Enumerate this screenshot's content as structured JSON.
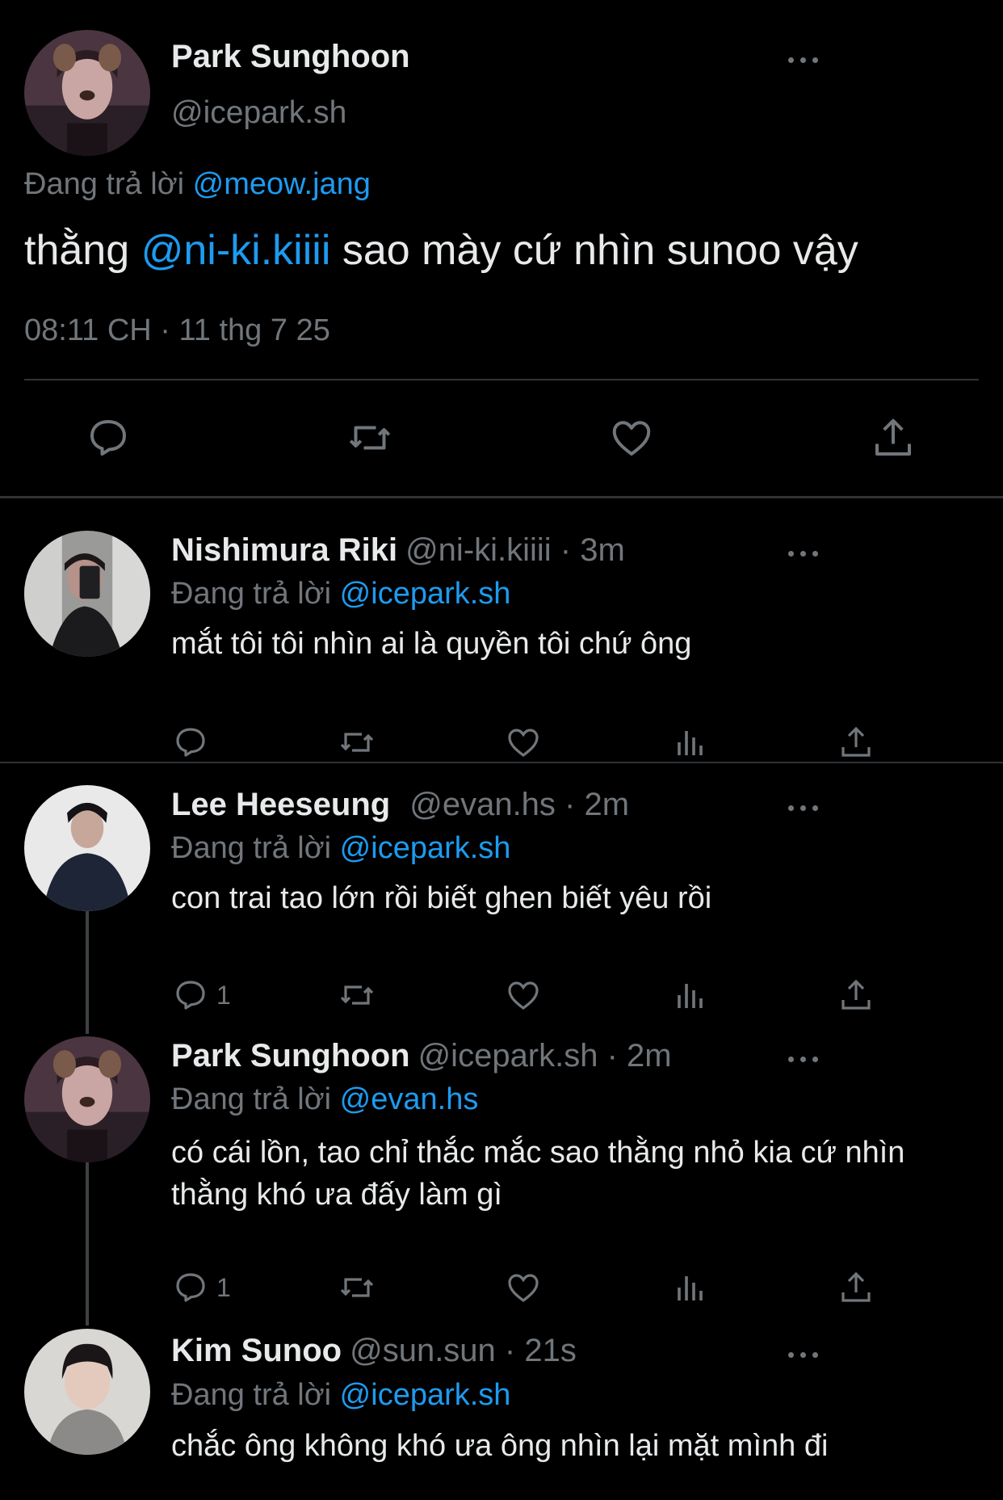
{
  "main_tweet": {
    "name": "Park Sunghoon",
    "handle": "@icepark.sh",
    "replying_prefix": "Đang trả lời",
    "replying_to": "@meow.jang",
    "text_before": "thằng",
    "text_mention": "@ni-ki.kiiii",
    "text_after": "sao mày cứ nhìn sunoo vậy",
    "timestamp": "08:11 CH · 11 thg 7 25",
    "actions": [
      "reply-icon",
      "retweet-icon",
      "like-icon",
      "share-icon"
    ]
  },
  "replies": [
    {
      "name": "Nishimura Riki",
      "meta": "@ni-ki.kiiii · 3m",
      "replying_prefix": "Đang trả lời",
      "replying_to": "@icepark.sh",
      "text": "mắt tôi tôi nhìn ai là quyền tôi chứ ông",
      "reply_count": ""
    },
    {
      "name": "Lee Heeseung",
      "meta": "@evan.hs · 2m",
      "replying_prefix": "Đang trả lời",
      "replying_to": "@icepark.sh",
      "text": "con trai tao lớn rồi biết ghen biết yêu rồi",
      "reply_count": "1"
    },
    {
      "name": "Park Sunghoon",
      "meta": "@icepark.sh · 2m",
      "replying_prefix": "Đang trả lời",
      "replying_to": "@evan.hs",
      "text": "có cái lồn, tao chỉ thắc mắc sao thằng nhỏ kia cứ nhìn thằng khó ưa đấy làm gì",
      "reply_count": "1"
    },
    {
      "name": "Kim Sunoo",
      "meta": "@sun.sun · 21s",
      "replying_prefix": "Đang trả lời",
      "replying_to": "@icepark.sh",
      "text": "chắc ông không khó ưa ông nhìn lại mặt mình đi",
      "reply_count": ""
    }
  ],
  "colors": {
    "background": "#000000",
    "text": "#e7e9ea",
    "muted": "#71767b",
    "link": "#1d9bf0",
    "divider": "#2f3336"
  }
}
